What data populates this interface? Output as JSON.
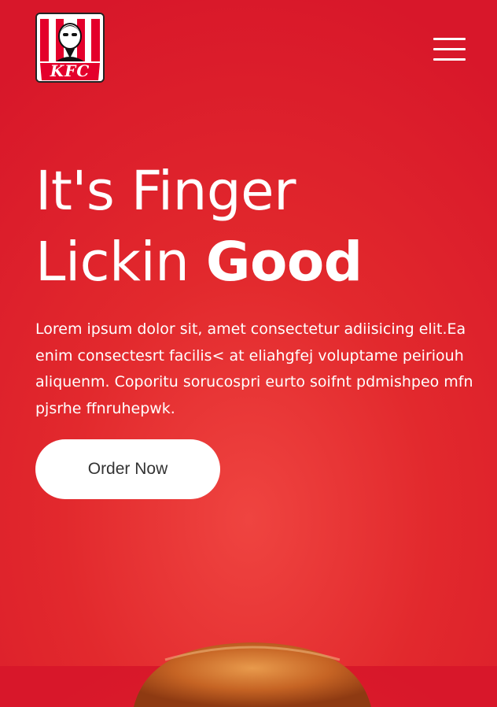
{
  "header": {
    "logo_text": "KFC",
    "menu_icon": "hamburger-menu-icon"
  },
  "hero": {
    "headline_line1": "It's Finger",
    "headline_line2_regular": "Lickin ",
    "headline_line2_bold": "Good",
    "description": "Lorem ipsum dolor sit, amet consectetur adiisicing elit.Ea enim consectesrt facilis< at eliahgfej voluptame peiriouh aliquenm. Coporitu sorucospri eurto soifnt pdmishpeo mfn pjsrhe ffnruhepwk.",
    "order_button_label": "Order Now"
  },
  "colors": {
    "brand_red": "#e2292d",
    "button_bg": "#ffffff",
    "button_text": "#333333"
  }
}
